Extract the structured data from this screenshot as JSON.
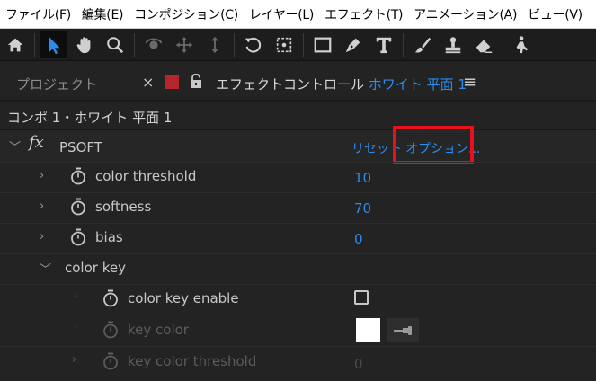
{
  "menubar": {
    "items": [
      "ファイル(F)",
      "編集(E)",
      "コンポジション(C)",
      "レイヤー(L)",
      "エフェクト(T)",
      "アニメーション(A)",
      "ビュー(V)"
    ]
  },
  "toolbar": {
    "tools": [
      "home-icon",
      "selection-arrow-icon",
      "hand-icon",
      "zoom-icon",
      "orbit-camera-icon",
      "pan-camera-icon",
      "dolly-camera-icon",
      "rotate-icon",
      "pan-behind-icon",
      "rectangle-icon",
      "pen-icon",
      "type-icon",
      "brush-icon",
      "clone-stamp-icon",
      "eraser-icon",
      "puppet-icon"
    ],
    "selected": "selection-arrow-icon"
  },
  "panel": {
    "project_tab": "プロジェクト",
    "close_glyph": "×",
    "effect_tab_prefix": "エフェクトコントロール",
    "effect_tab_layer": "ホワイト 平面 1",
    "menu_glyph": "≡",
    "comp_title": "コンポ 1・ホワイト 平面 1"
  },
  "effect": {
    "fx": "fx",
    "name": "PSOFT",
    "reset": "リセット",
    "options": "オプション..."
  },
  "params": [
    {
      "label": "color threshold",
      "value": "10"
    },
    {
      "label": "softness",
      "value": "70"
    },
    {
      "label": "bias",
      "value": "0"
    }
  ],
  "group": {
    "label": "color key",
    "enable_label": "color key enable",
    "enable_checked": false,
    "key_color_label": "key color",
    "key_color": "#ffffff",
    "key_threshold_label": "key color threshold",
    "key_threshold_value": "0"
  },
  "colors": {
    "accent": "#2d8ceb",
    "highlight": "#e8101a",
    "panel_bg": "#232323"
  }
}
